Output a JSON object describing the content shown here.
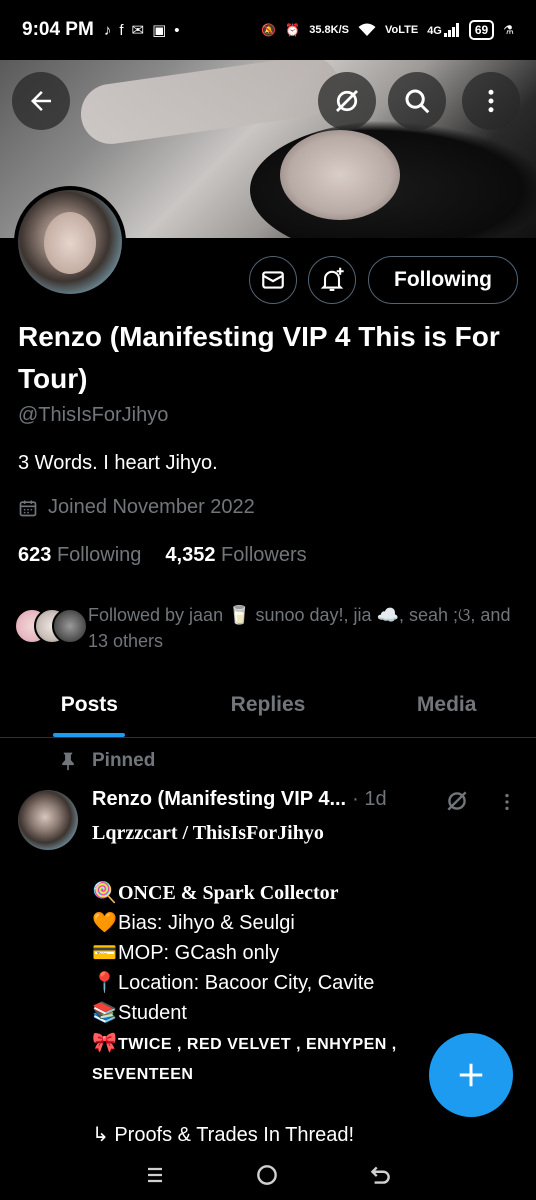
{
  "status_bar": {
    "time": "9:04 PM",
    "speed_value": "35.8",
    "speed_unit": "K/S",
    "network_vo": "Vo",
    "network_lte": "LTE",
    "network_4g": "4G",
    "battery": "69"
  },
  "header": {
    "back_icon": "arrow-left-icon",
    "grok_icon": "grok-icon",
    "search_icon": "search-icon",
    "more_icon": "more-vertical-icon"
  },
  "profile": {
    "following_button": "Following",
    "display_name": "Renzo (Manifesting VIP 4 This is For Tour)",
    "handle": "@ThisIsForJihyo",
    "bio": "3 Words. I heart Jihyo.",
    "joined": "Joined November 2022",
    "following_count": "623",
    "following_label": "Following",
    "followers_count": "4,352",
    "followers_label": "Followers",
    "followed_by": "Followed by jaan 🥛 sunoo day!, jia ☁️, seah ;ଓ, and 13 others"
  },
  "tabs": [
    {
      "label": "Posts",
      "active": true
    },
    {
      "label": "Replies",
      "active": false
    },
    {
      "label": "Media",
      "active": false
    }
  ],
  "pinned_post": {
    "pinned_label": "Pinned",
    "author": "Renzo (Manifesting VIP 4...",
    "time": "· 1d",
    "line1": "Lqrzzcart / ThisIsForJihyo",
    "line2_emoji": "🍭",
    "line2": "ONCE & Spark Collector",
    "line3_emoji": "🧡",
    "line3": "Bias: Jihyo & Seulgi",
    "line4_emoji": "💳",
    "line4": "MOP: GCash only",
    "line5_emoji": "📍",
    "line5": "Location: Bacoor City, Cavite",
    "line6_emoji": "📚",
    "line6": "Student",
    "line7_emoji": "🎀",
    "line7": "TWICE , RED VELVET , ENHYPEN ,",
    "line8": "SEVENTEEN",
    "line9": "↳ Proofs & Trades In Thread!"
  },
  "fab_label": "+",
  "colors": {
    "accent": "#1d9bf0",
    "background": "#000000",
    "muted_text": "#71767b"
  }
}
